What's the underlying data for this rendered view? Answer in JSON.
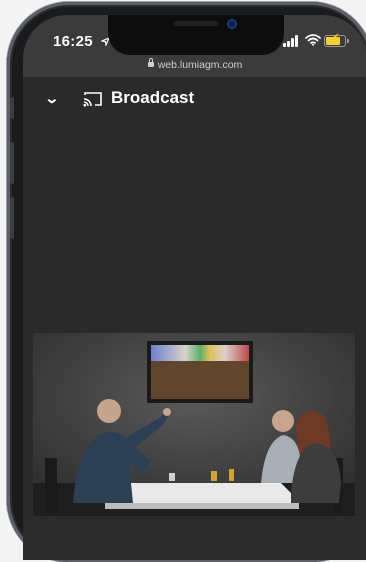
{
  "status_bar": {
    "time": "16:25",
    "location_icon": "location-arrow-icon",
    "signal_icon": "cellular-signal-icon",
    "wifi_icon": "wifi-icon",
    "battery_icon": "battery-charging-icon",
    "battery_color": "#f3d32a"
  },
  "browser": {
    "url": "web.lumiagm.com",
    "lock_icon": "lock-icon"
  },
  "app_bar": {
    "collapse_icon": "chevron-down-icon",
    "cast_icon": "cast-icon",
    "title": "Broadcast"
  },
  "broadcast": {
    "video_description_icon": "video-frame"
  },
  "colors": {
    "background": "#2a2a2a",
    "status_bar": "#3b3b3b",
    "text": "#ffffff"
  }
}
